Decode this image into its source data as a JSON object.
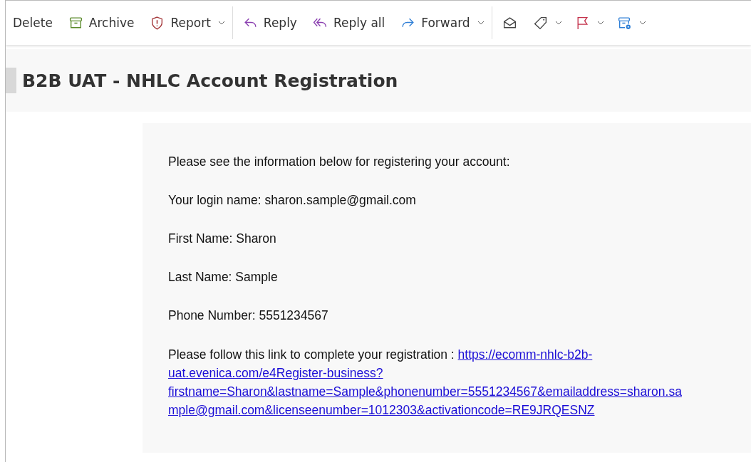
{
  "toolbar": {
    "groups": [
      [
        {
          "label": "Delete",
          "dropdown": false
        },
        {
          "label": "Archive",
          "dropdown": false
        },
        {
          "label": "Report",
          "dropdown": true
        }
      ],
      [
        {
          "label": "Reply",
          "dropdown": false
        },
        {
          "label": "Reply all",
          "dropdown": false
        },
        {
          "label": "Forward",
          "dropdown": true
        }
      ],
      [
        {
          "dropdown": false
        },
        {
          "dropdown": true
        },
        {
          "dropdown": true
        },
        {
          "dropdown": true
        }
      ]
    ]
  },
  "subject": "B2B UAT - NHLC Account Registration",
  "body": {
    "paragraphs": [
      "Please see the information below for registering your account:",
      "Your login name: sharon.sample@gmail.com",
      "First Name: Sharon",
      "Last Name: Sample",
      "Phone Number: 5551234567"
    ],
    "link_intro": "Please follow this link to complete your registration :",
    "link_lines": [
      "https://ecomm-nhlc-b2b-",
      "uat.evenica.com/e4Register-business?",
      "firstname=Sharon&lastname=Sample&phonenumber=5551234567&emailaddress=sharon.sa",
      "mple@gmail.com&licenseenumber=1012303&activationcode=RE9JRQESNZ"
    ]
  }
}
